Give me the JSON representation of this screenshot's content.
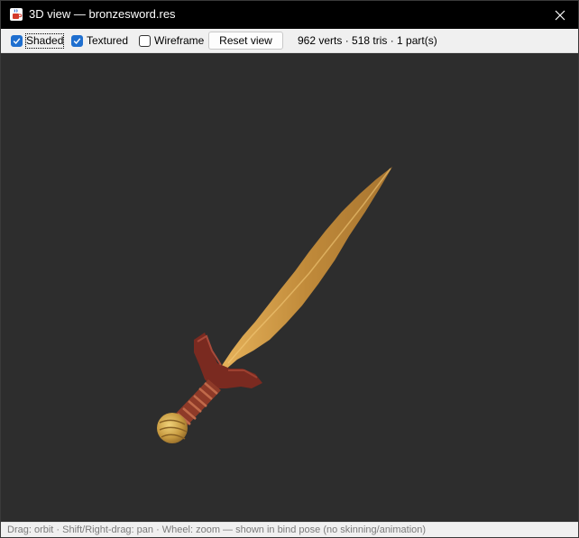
{
  "window": {
    "title": "3D view — bronzesword.res"
  },
  "toolbar": {
    "shaded": {
      "label": "Shaded",
      "checked": true
    },
    "textured": {
      "label": "Textured",
      "checked": true
    },
    "wireframe": {
      "label": "Wireframe",
      "checked": false
    },
    "reset_label": "Reset view",
    "stats": "962 verts · 518 tris · 1 part(s)"
  },
  "viewport": {
    "background": "#2d2d2d",
    "model_colors": {
      "blade": "#c8953f",
      "guard": "#7a2a20",
      "grip": "#8e3a28",
      "pommel": "#c9a24a"
    }
  },
  "status": {
    "hint": "Drag: orbit · Shift/Right-drag: pan · Wheel: zoom — shown in bind pose (no skinning/animation)"
  },
  "icons": {
    "app": "java-cup-icon",
    "close": "close-icon",
    "check": "check-icon"
  }
}
